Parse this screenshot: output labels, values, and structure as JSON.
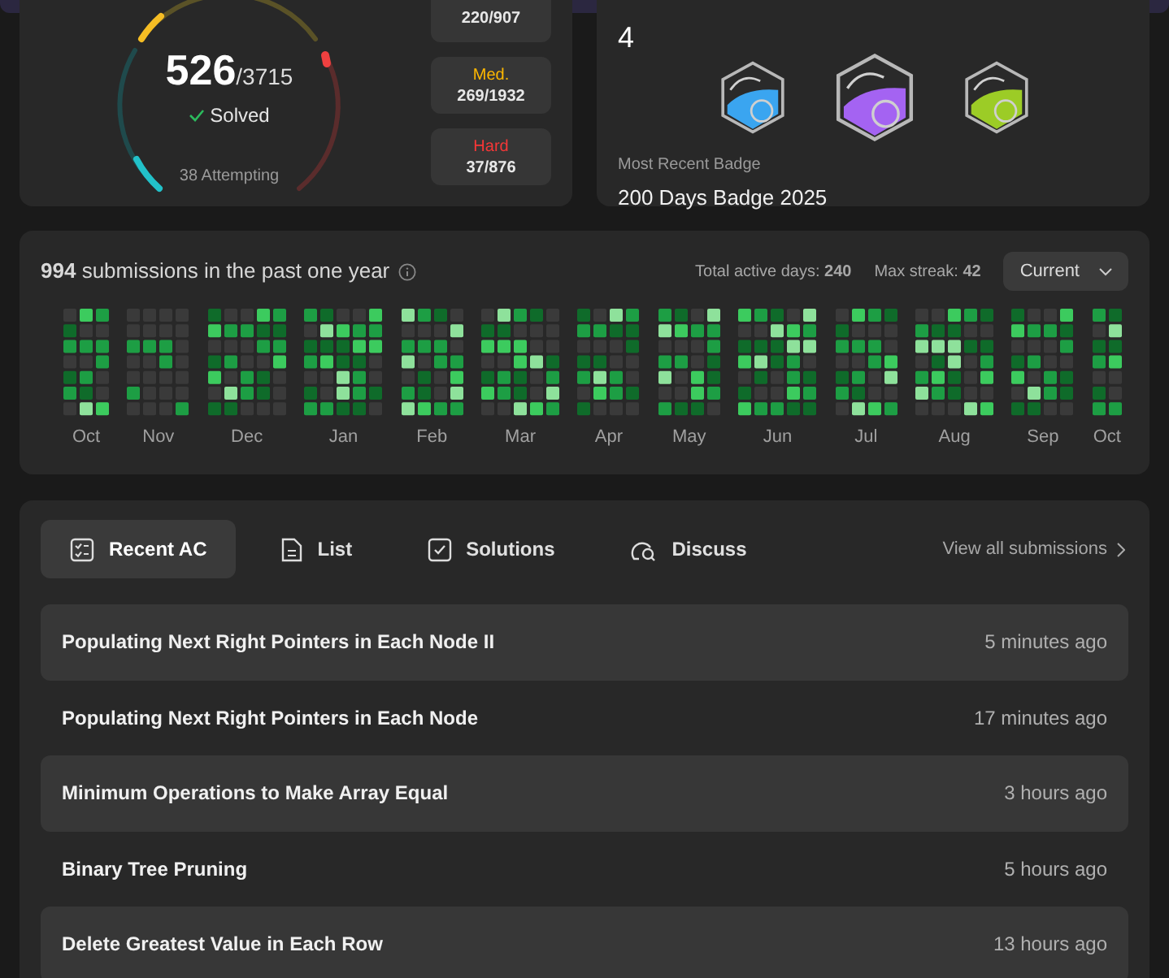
{
  "solved": {
    "count": "526",
    "total": "/3715",
    "label": "Solved",
    "attempting": "38 Attempting"
  },
  "difficulties": [
    {
      "count": "220/907"
    },
    {
      "kind": "medium",
      "label": "Med.",
      "count": "269/1932"
    },
    {
      "kind": "hard",
      "label": "Hard",
      "count": "37/876"
    }
  ],
  "badges": {
    "count": "4",
    "recent_label": "Most Recent Badge",
    "recent_name": "200 Days Badge 2025"
  },
  "calendar": {
    "headline": "**994** submissions in the past one year",
    "active_days": "Total active days: **240**",
    "max_streak": "Max streak: **42**",
    "range": "Current",
    "months": [
      "Oct",
      "Nov",
      "Dec",
      "Jan",
      "Feb",
      "Mar",
      "Apr",
      "May",
      "Jun",
      "Jul",
      "Aug",
      "Sep",
      "Oct"
    ]
  },
  "tabs": [
    {
      "label": "Recent AC",
      "selected": true
    },
    {
      "label": "List",
      "selected": false
    },
    {
      "label": "Solutions",
      "selected": false
    },
    {
      "label": "Discuss",
      "selected": false
    }
  ],
  "view_all": "View all submissions",
  "submissions": [
    {
      "title": "Populating Next Right Pointers in Each Node II",
      "time": "5 minutes ago"
    },
    {
      "title": "Populating Next Right Pointers in Each Node",
      "time": "17 minutes ago"
    },
    {
      "title": "Minimum Operations to Make Array Equal",
      "time": "3 hours ago"
    },
    {
      "title": "Binary Tree Pruning",
      "time": "5 hours ago"
    },
    {
      "title": "Delete Greatest Value in Each Row",
      "time": "13 hours ago"
    }
  ]
}
